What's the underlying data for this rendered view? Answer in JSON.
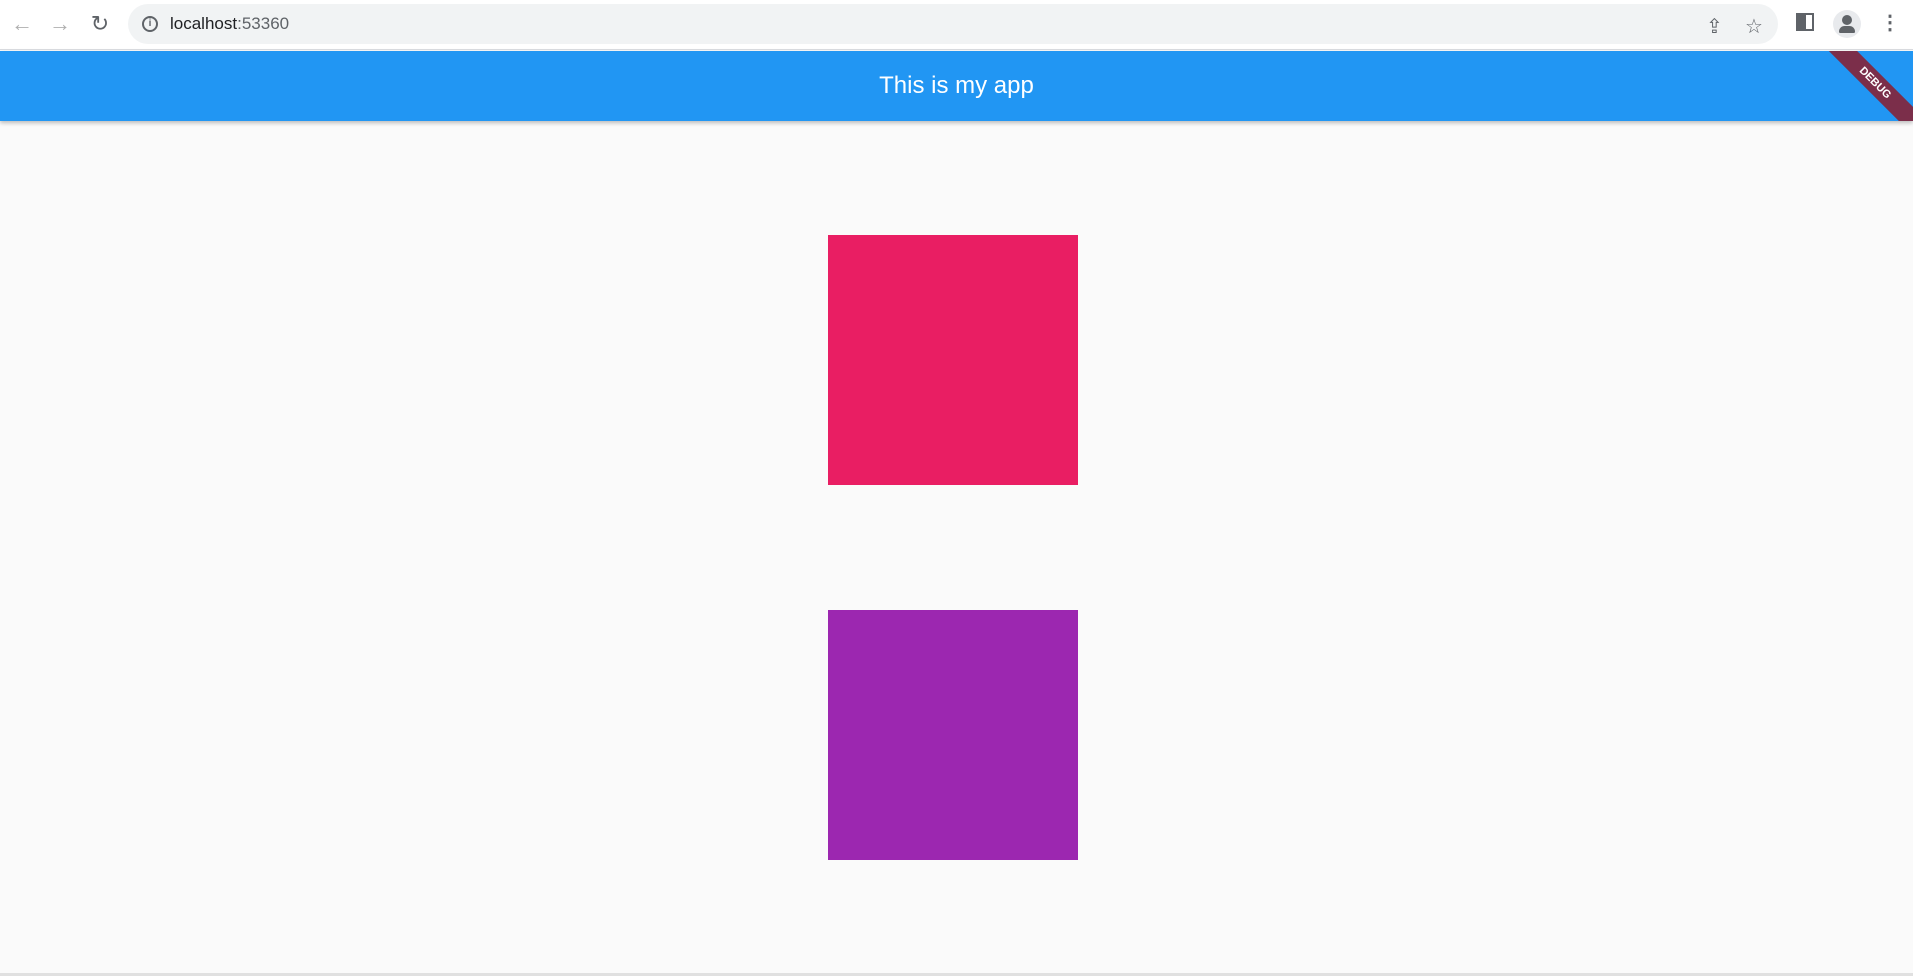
{
  "browser": {
    "url_host": "localhost",
    "url_port": ":53360"
  },
  "app": {
    "title": "This is my app",
    "debug_banner": "DEBUG"
  },
  "boxes": [
    {
      "color": "#e91e63"
    },
    {
      "color": "#9c27b0"
    }
  ],
  "colors": {
    "appbar": "#2196f3",
    "background": "#fafafa"
  }
}
